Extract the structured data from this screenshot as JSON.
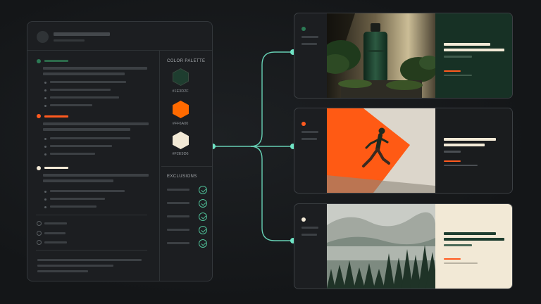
{
  "palette": {
    "title": "COLOR PALETTE",
    "swatches": [
      {
        "hex": "#1E3D2F",
        "color": "#1e3d2f"
      },
      {
        "hex": "#FF6A00",
        "color": "#ff6a00"
      },
      {
        "hex": "#F2E9D6",
        "color": "#f2e9d6"
      }
    ]
  },
  "exclusions": {
    "title": "EXCLUSIONS",
    "count": 5
  },
  "colors": {
    "accent_connector": "#6fe3c4",
    "check_green": "#4fbf97",
    "green_dot": "#2c7a55",
    "orange": "#ff5a1f",
    "cream": "#f2e9d6",
    "card_green_bg": "#173125",
    "card_dark_bg": "#1a1c1e"
  },
  "cards": [
    {
      "name": "product-bottle-card",
      "image": "green-bottle-product-photo",
      "panel": "dark-green"
    },
    {
      "name": "runner-card",
      "image": "runner-orange-wall-photo",
      "panel": "dark"
    },
    {
      "name": "forest-card",
      "image": "misty-forest-photo",
      "panel": "cream"
    }
  ]
}
